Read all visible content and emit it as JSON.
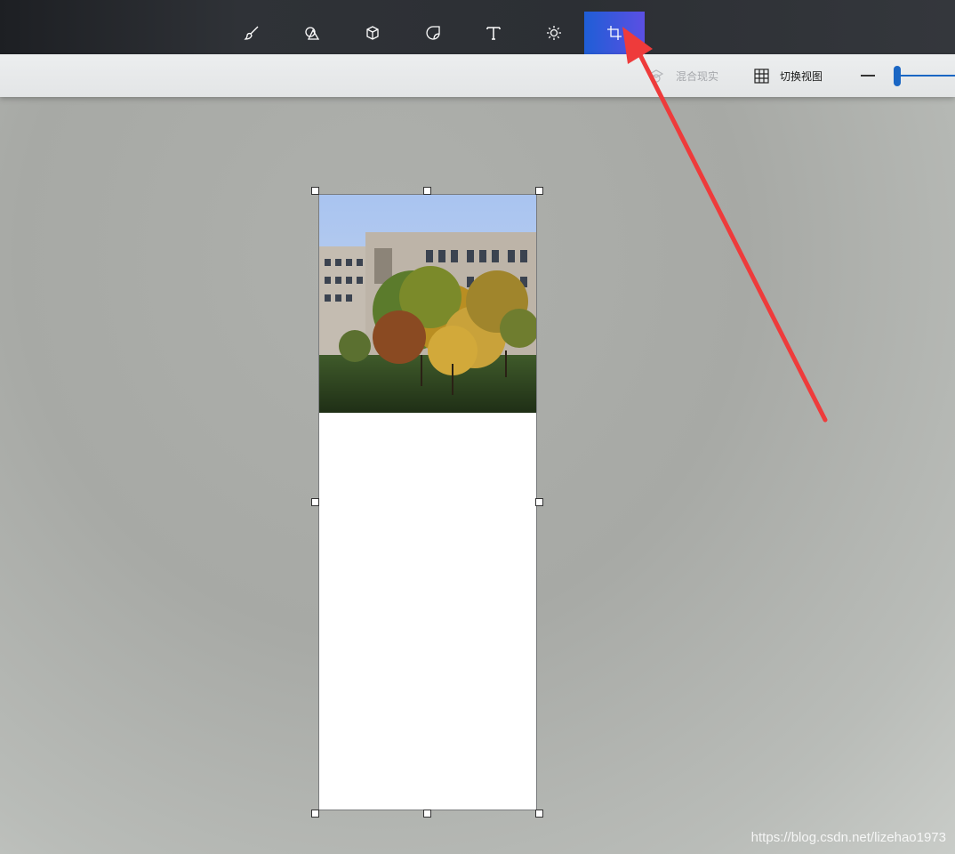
{
  "toolbar": {
    "tools": [
      {
        "name": "brushes",
        "icon": "brush-icon",
        "active": false
      },
      {
        "name": "2d-shapes",
        "icon": "shapes-icon",
        "active": false
      },
      {
        "name": "3d-shapes",
        "icon": "cube-icon",
        "active": false
      },
      {
        "name": "stickers",
        "icon": "sticker-icon",
        "active": false
      },
      {
        "name": "text",
        "icon": "text-icon",
        "active": false
      },
      {
        "name": "effects",
        "icon": "sun-icon",
        "active": false
      },
      {
        "name": "canvas",
        "icon": "crop-canvas-icon",
        "active": true
      }
    ],
    "active_gradient": [
      "#1f5ed6",
      "#5b4fe3"
    ]
  },
  "subbar": {
    "mixed_reality_label": "混合现实",
    "mixed_reality_icon": "mixed-reality-icon",
    "switch_view_label": "切换视图",
    "switch_view_icon": "grid-icon",
    "zoom_minus_icon": "minus-icon"
  },
  "colors": {
    "accent": "#1a66c4",
    "arrow": "#ee3b3b"
  },
  "watermark": "https://blog.csdn.net/lizehao1973"
}
